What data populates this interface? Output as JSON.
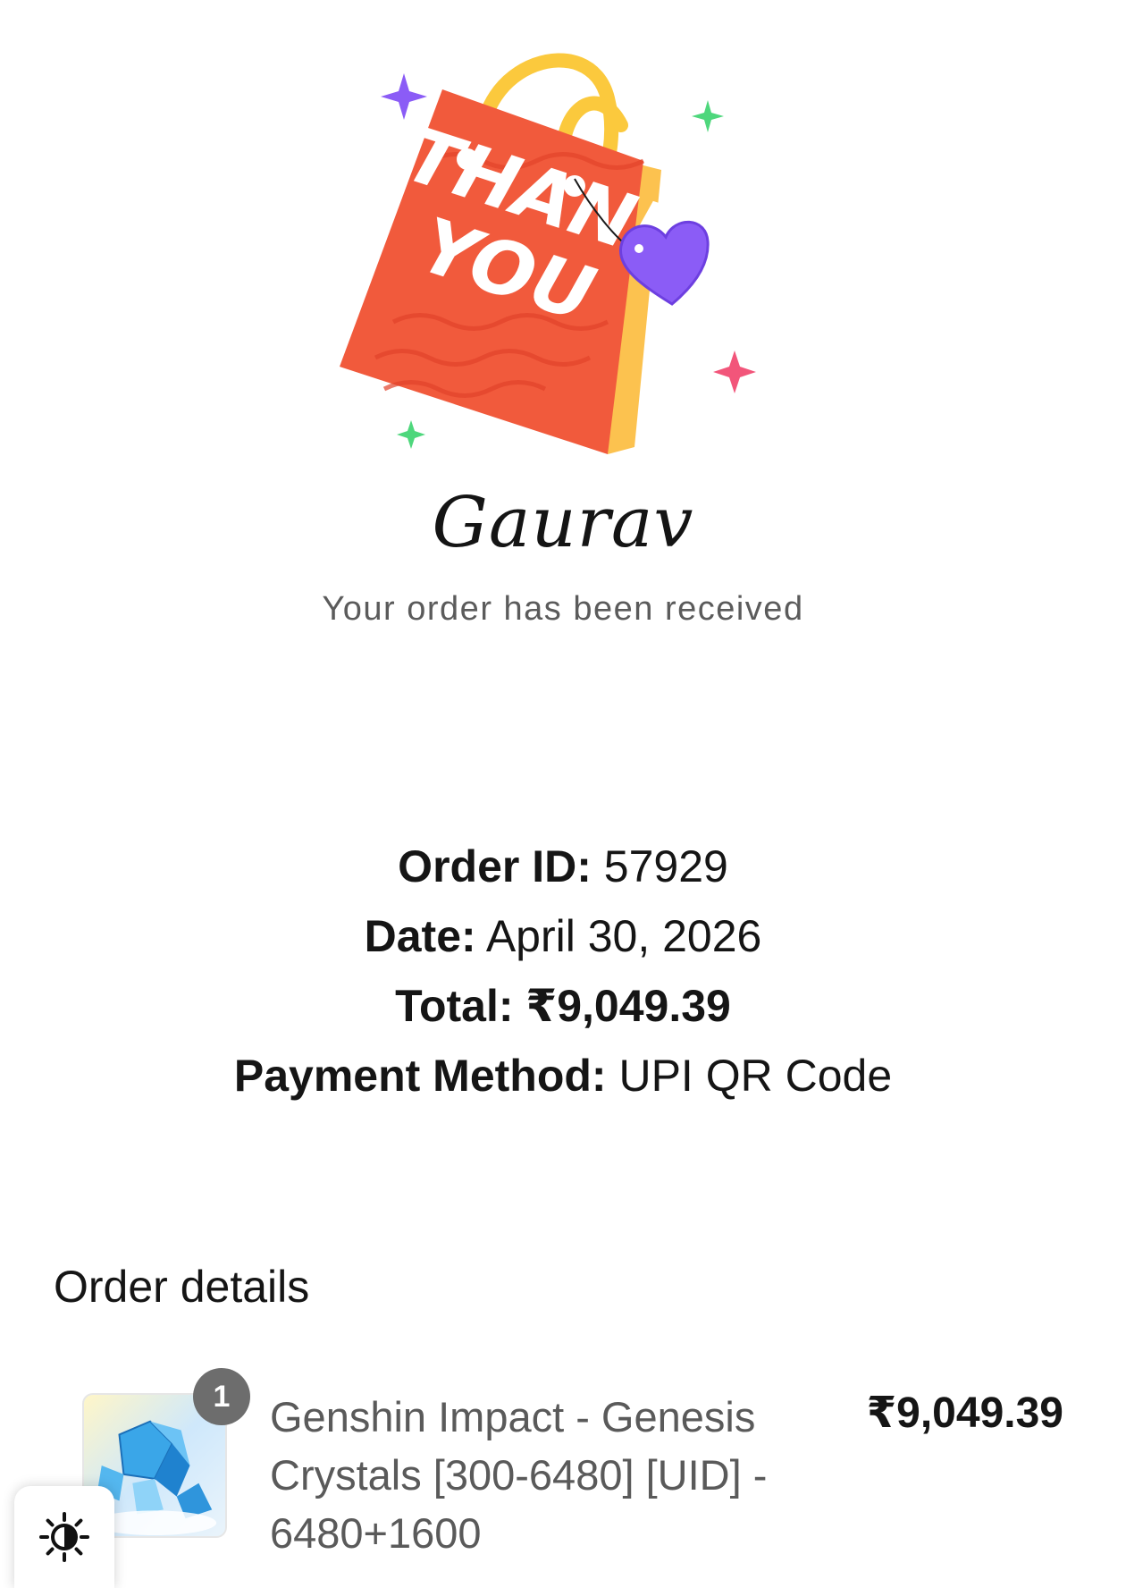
{
  "hero": {
    "bag_text": "THANK YOU",
    "colors": {
      "bag": "#f15a3c",
      "bag_side": "#fcc24f",
      "handle": "#fbc93d",
      "heart": "#8b5cf6",
      "sparkle_purple": "#8b5cf6",
      "sparkle_green": "#4ed77c",
      "sparkle_pink": "#f2557a"
    }
  },
  "customer": {
    "name": "Gaurav",
    "status": "Your order has been received"
  },
  "summary": {
    "order_id_label": "Order ID:",
    "order_id": "57929",
    "date_label": "Date:",
    "date": "April 30, 2026",
    "total_label": "Total:",
    "total": "₹9,049.39",
    "payment_label": "Payment Method:",
    "payment": "UPI QR Code"
  },
  "order_details": {
    "heading": "Order details",
    "items": [
      {
        "quantity": "1",
        "name": "Genshin Impact - Genesis Crystals [300-6480] [UID] - 6480+1600",
        "price": "₹9,049.39",
        "thumbnail_icon": "genesis-crystals-icon"
      }
    ]
  },
  "theme_toggle": {
    "icon": "contrast-sun-icon"
  }
}
